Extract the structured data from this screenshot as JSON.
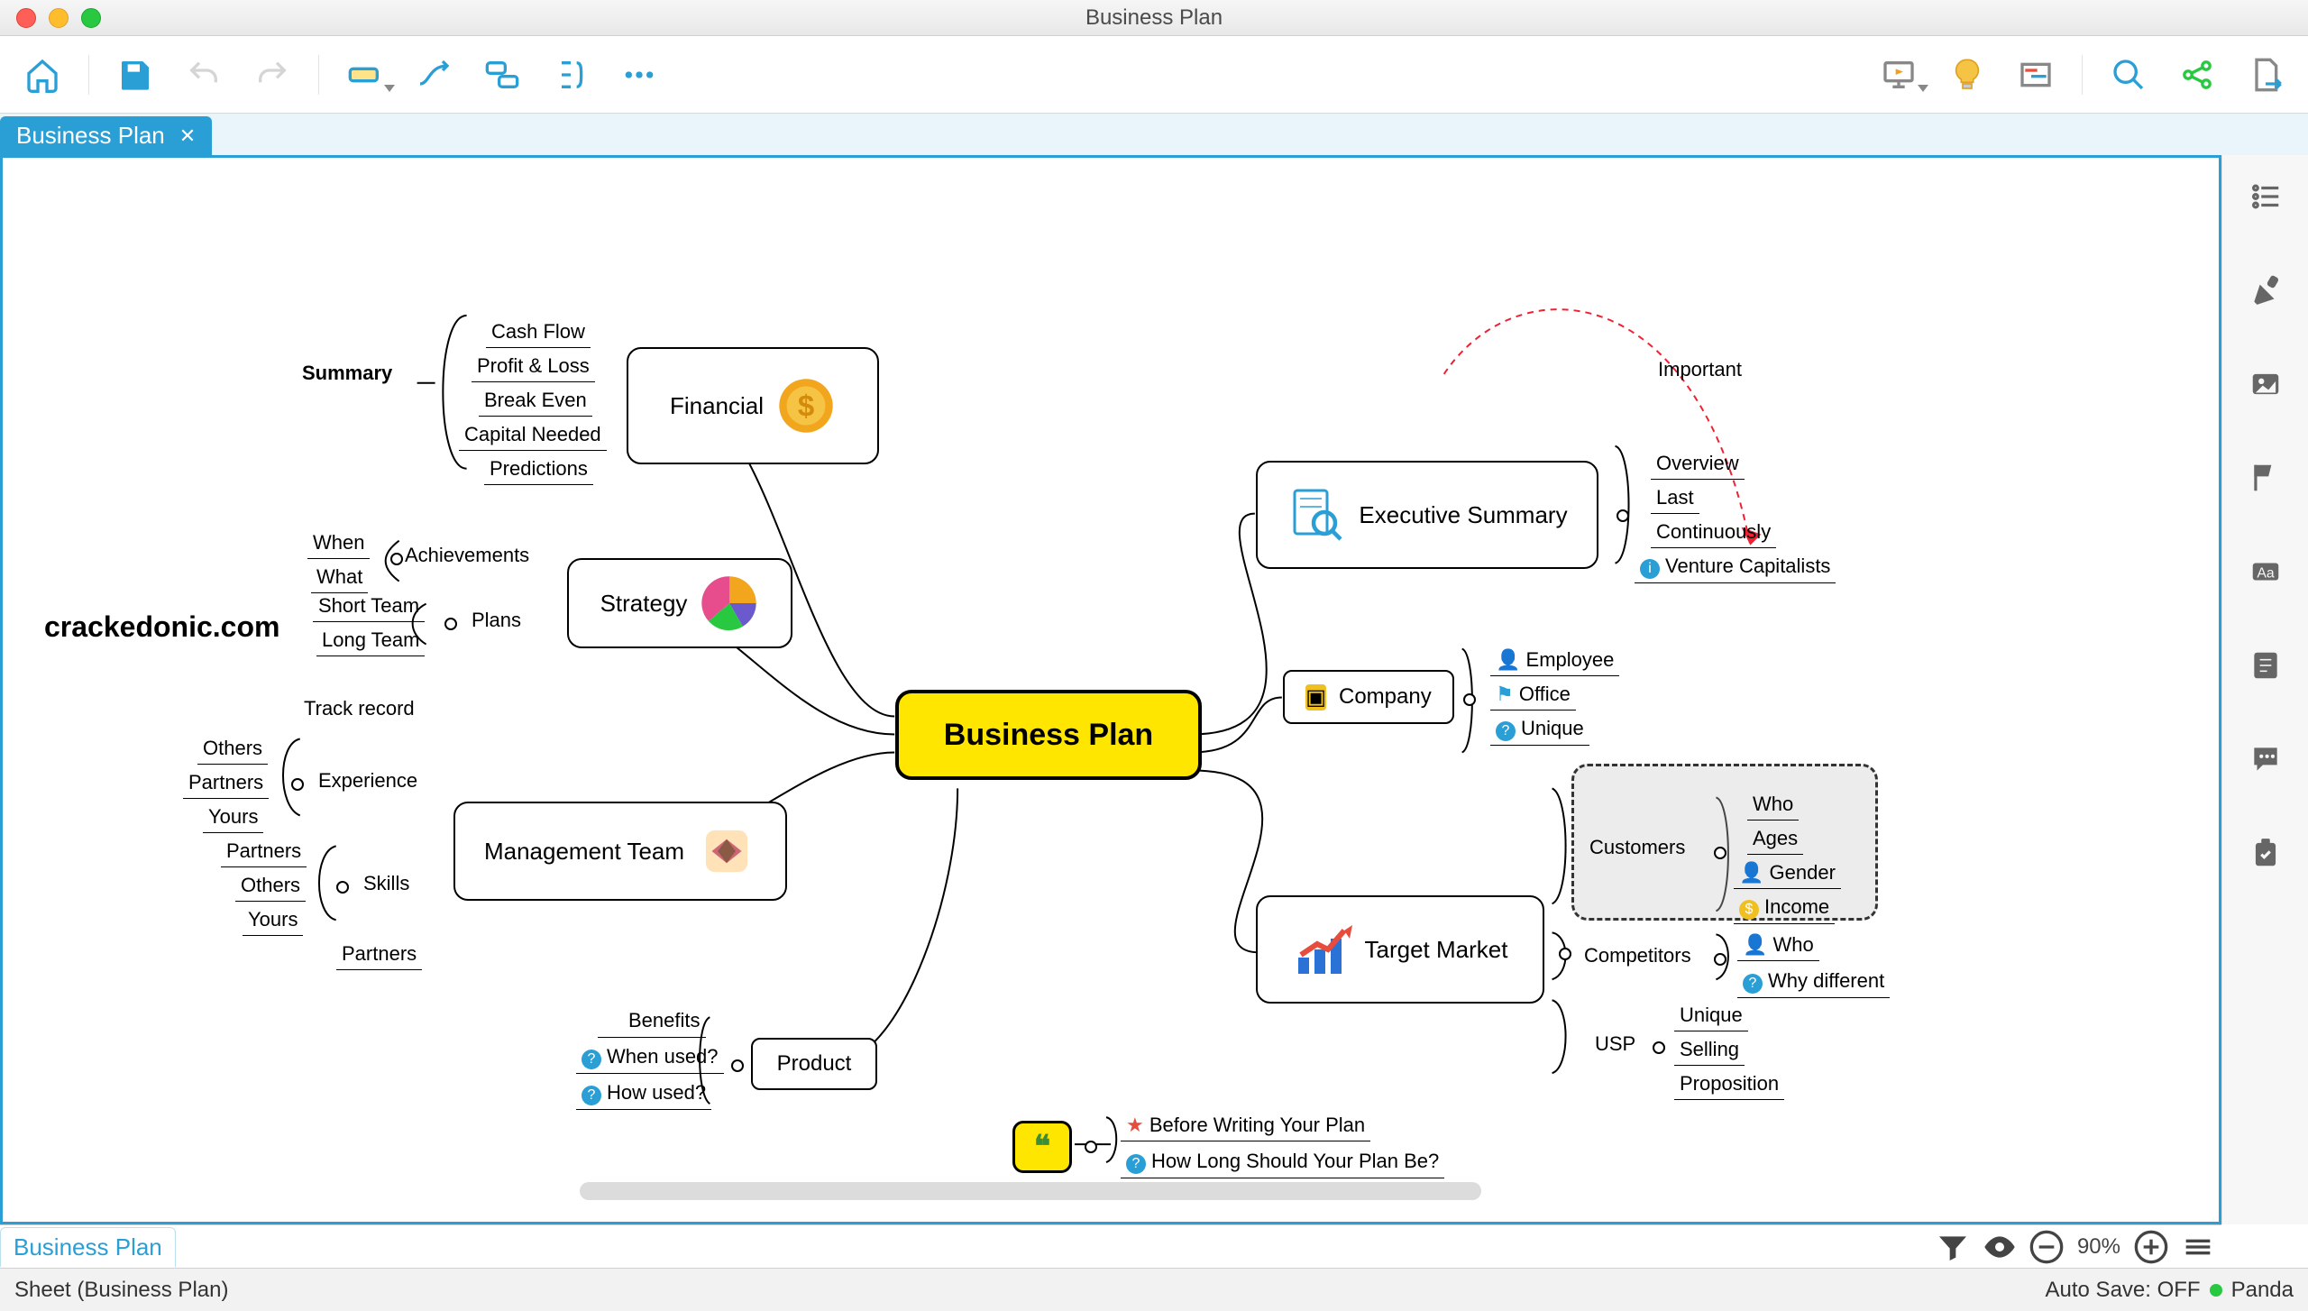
{
  "window": {
    "title": "Business Plan"
  },
  "tab": {
    "label": "Business Plan"
  },
  "sheet_tab": {
    "label": "Business Plan"
  },
  "status": {
    "sheet": "Sheet (Business Plan)",
    "autosave": "Auto Save: OFF",
    "user": "Panda"
  },
  "zoom": {
    "label": "90%"
  },
  "watermark": "crackedonic.com",
  "map": {
    "central": "Business Plan",
    "financial": {
      "label": "Financial",
      "summary_label": "Summary",
      "items": [
        "Cash Flow",
        "Profit & Loss",
        "Break Even",
        "Capital Needed",
        "Predictions"
      ]
    },
    "strategy": {
      "label": "Strategy",
      "achievements_label": "Achievements",
      "achievements": [
        "When",
        "What"
      ],
      "plans_label": "Plans",
      "plans": [
        "Short Team",
        "Long Team"
      ]
    },
    "mgmt": {
      "label": "Management Team",
      "track_record_label": "Track record",
      "experience_label": "Experience",
      "experience": [
        "Others",
        "Partners",
        "Yours"
      ],
      "skills_label": "Skills",
      "skills": [
        "Partners",
        "Others",
        "Yours"
      ],
      "partners_leaf": "Partners"
    },
    "product": {
      "label": "Product",
      "items": [
        "Benefits",
        "When used?",
        "How used?"
      ]
    },
    "exec": {
      "label": "Executive Summary",
      "important_label": "Important",
      "items": [
        "Overview",
        "Last",
        "Continuously",
        "Venture Capitalists"
      ]
    },
    "company": {
      "label": "Company",
      "items": [
        "Employee",
        "Office",
        "Unique"
      ]
    },
    "target": {
      "label": "Target Market",
      "customers_label": "Customers",
      "customers": [
        "Who",
        "Ages",
        "Gender",
        "Income"
      ],
      "competitors_label": "Competitors",
      "competitors": [
        "Who",
        "Why different"
      ],
      "usp_label": "USP",
      "usp": [
        "Unique",
        "Selling",
        "Proposition"
      ]
    },
    "notes": {
      "before": "Before Writing Your Plan",
      "howlong": "How Long Should Your Plan Be?"
    }
  }
}
